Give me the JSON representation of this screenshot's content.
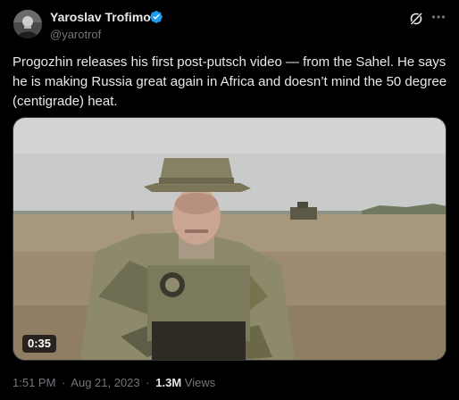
{
  "author": {
    "name": "Yaroslav Trofimov",
    "handle": "@yarotrof",
    "verified": true,
    "verified_color": "#1d9bf0"
  },
  "icons": {
    "avatar": "avatar-photo",
    "verified": "verified-badge-icon",
    "grok": "grok-icon",
    "more": "more-horizontal-icon"
  },
  "tweet": {
    "text": "Progozhin releases his first post-putsch video — from the Sahel. He says\nhe is making Russia great again in Africa and doesn’t mind the 50 degree\n(centigrade) heat."
  },
  "media": {
    "type": "video",
    "duration": "0:35"
  },
  "meta": {
    "time": "1:51 PM",
    "date": "Aug 21, 2023",
    "separator": "·",
    "views_count": "1.3M",
    "views_label": "Views"
  },
  "colors": {
    "background": "#000000",
    "text_primary": "#e7e9ea",
    "text_secondary": "#71767b",
    "border": "#2f3336"
  }
}
